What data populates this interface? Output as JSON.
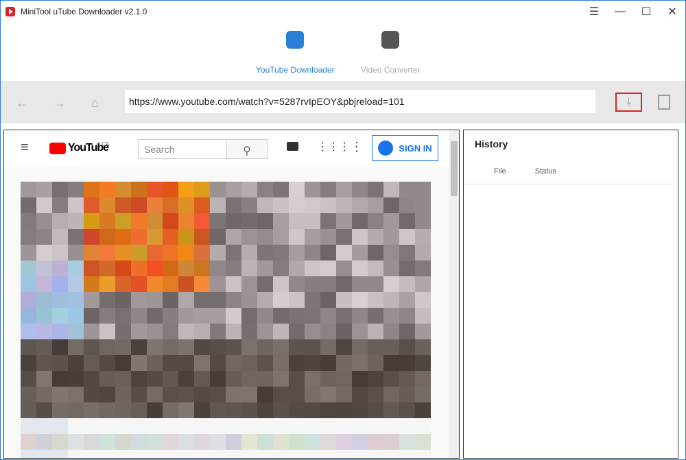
{
  "window": {
    "title": "MiniTool uTube Downloader v2.1.0"
  },
  "modes": [
    {
      "label": "YouTube Downloader",
      "active": true,
      "icon": "video-download-icon",
      "color": "#2b7fd6"
    },
    {
      "label": "Video Converter",
      "active": false,
      "icon": "convert-icon",
      "color": "#aaaaaa"
    }
  ],
  "toolbar": {
    "url": "https://www.youtube.com/watch?v=5287rvIpEOY&pbjreload=101"
  },
  "youtube": {
    "logo": "YouTube",
    "region": "CA",
    "search_placeholder": "Search",
    "sign_in": "SIGN IN"
  },
  "history": {
    "title": "History",
    "columns": [
      "File",
      "Status"
    ]
  }
}
